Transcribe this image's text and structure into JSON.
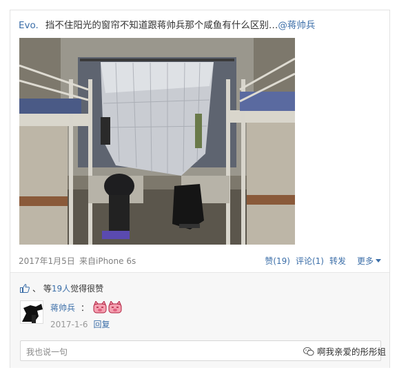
{
  "post": {
    "author": "Evo.",
    "text": "挡不住阳光的窗帘不知道跟蒋帅兵那个咸鱼有什么区别…",
    "mention": "@蒋帅兵"
  },
  "meta": {
    "date": "2017年1月5日",
    "source": "来自iPhone 6s",
    "like": "赞(19)",
    "comment": "评论(1)",
    "repost": "转发",
    "more": "更多"
  },
  "likes": {
    "prefix": "、 等",
    "count": "19人",
    "suffix": "觉得很赞"
  },
  "comment": {
    "name": "蒋帅兵",
    "colon": "：",
    "date": "2017-1-6",
    "reply": "回复"
  },
  "input": {
    "placeholder": "我也说一句"
  },
  "watermark": {
    "text": "啊我亲爱的彤彤姐"
  },
  "colors": {
    "link": "#3b6ea8",
    "meta": "#808080",
    "panel": "#f7f7f7"
  }
}
